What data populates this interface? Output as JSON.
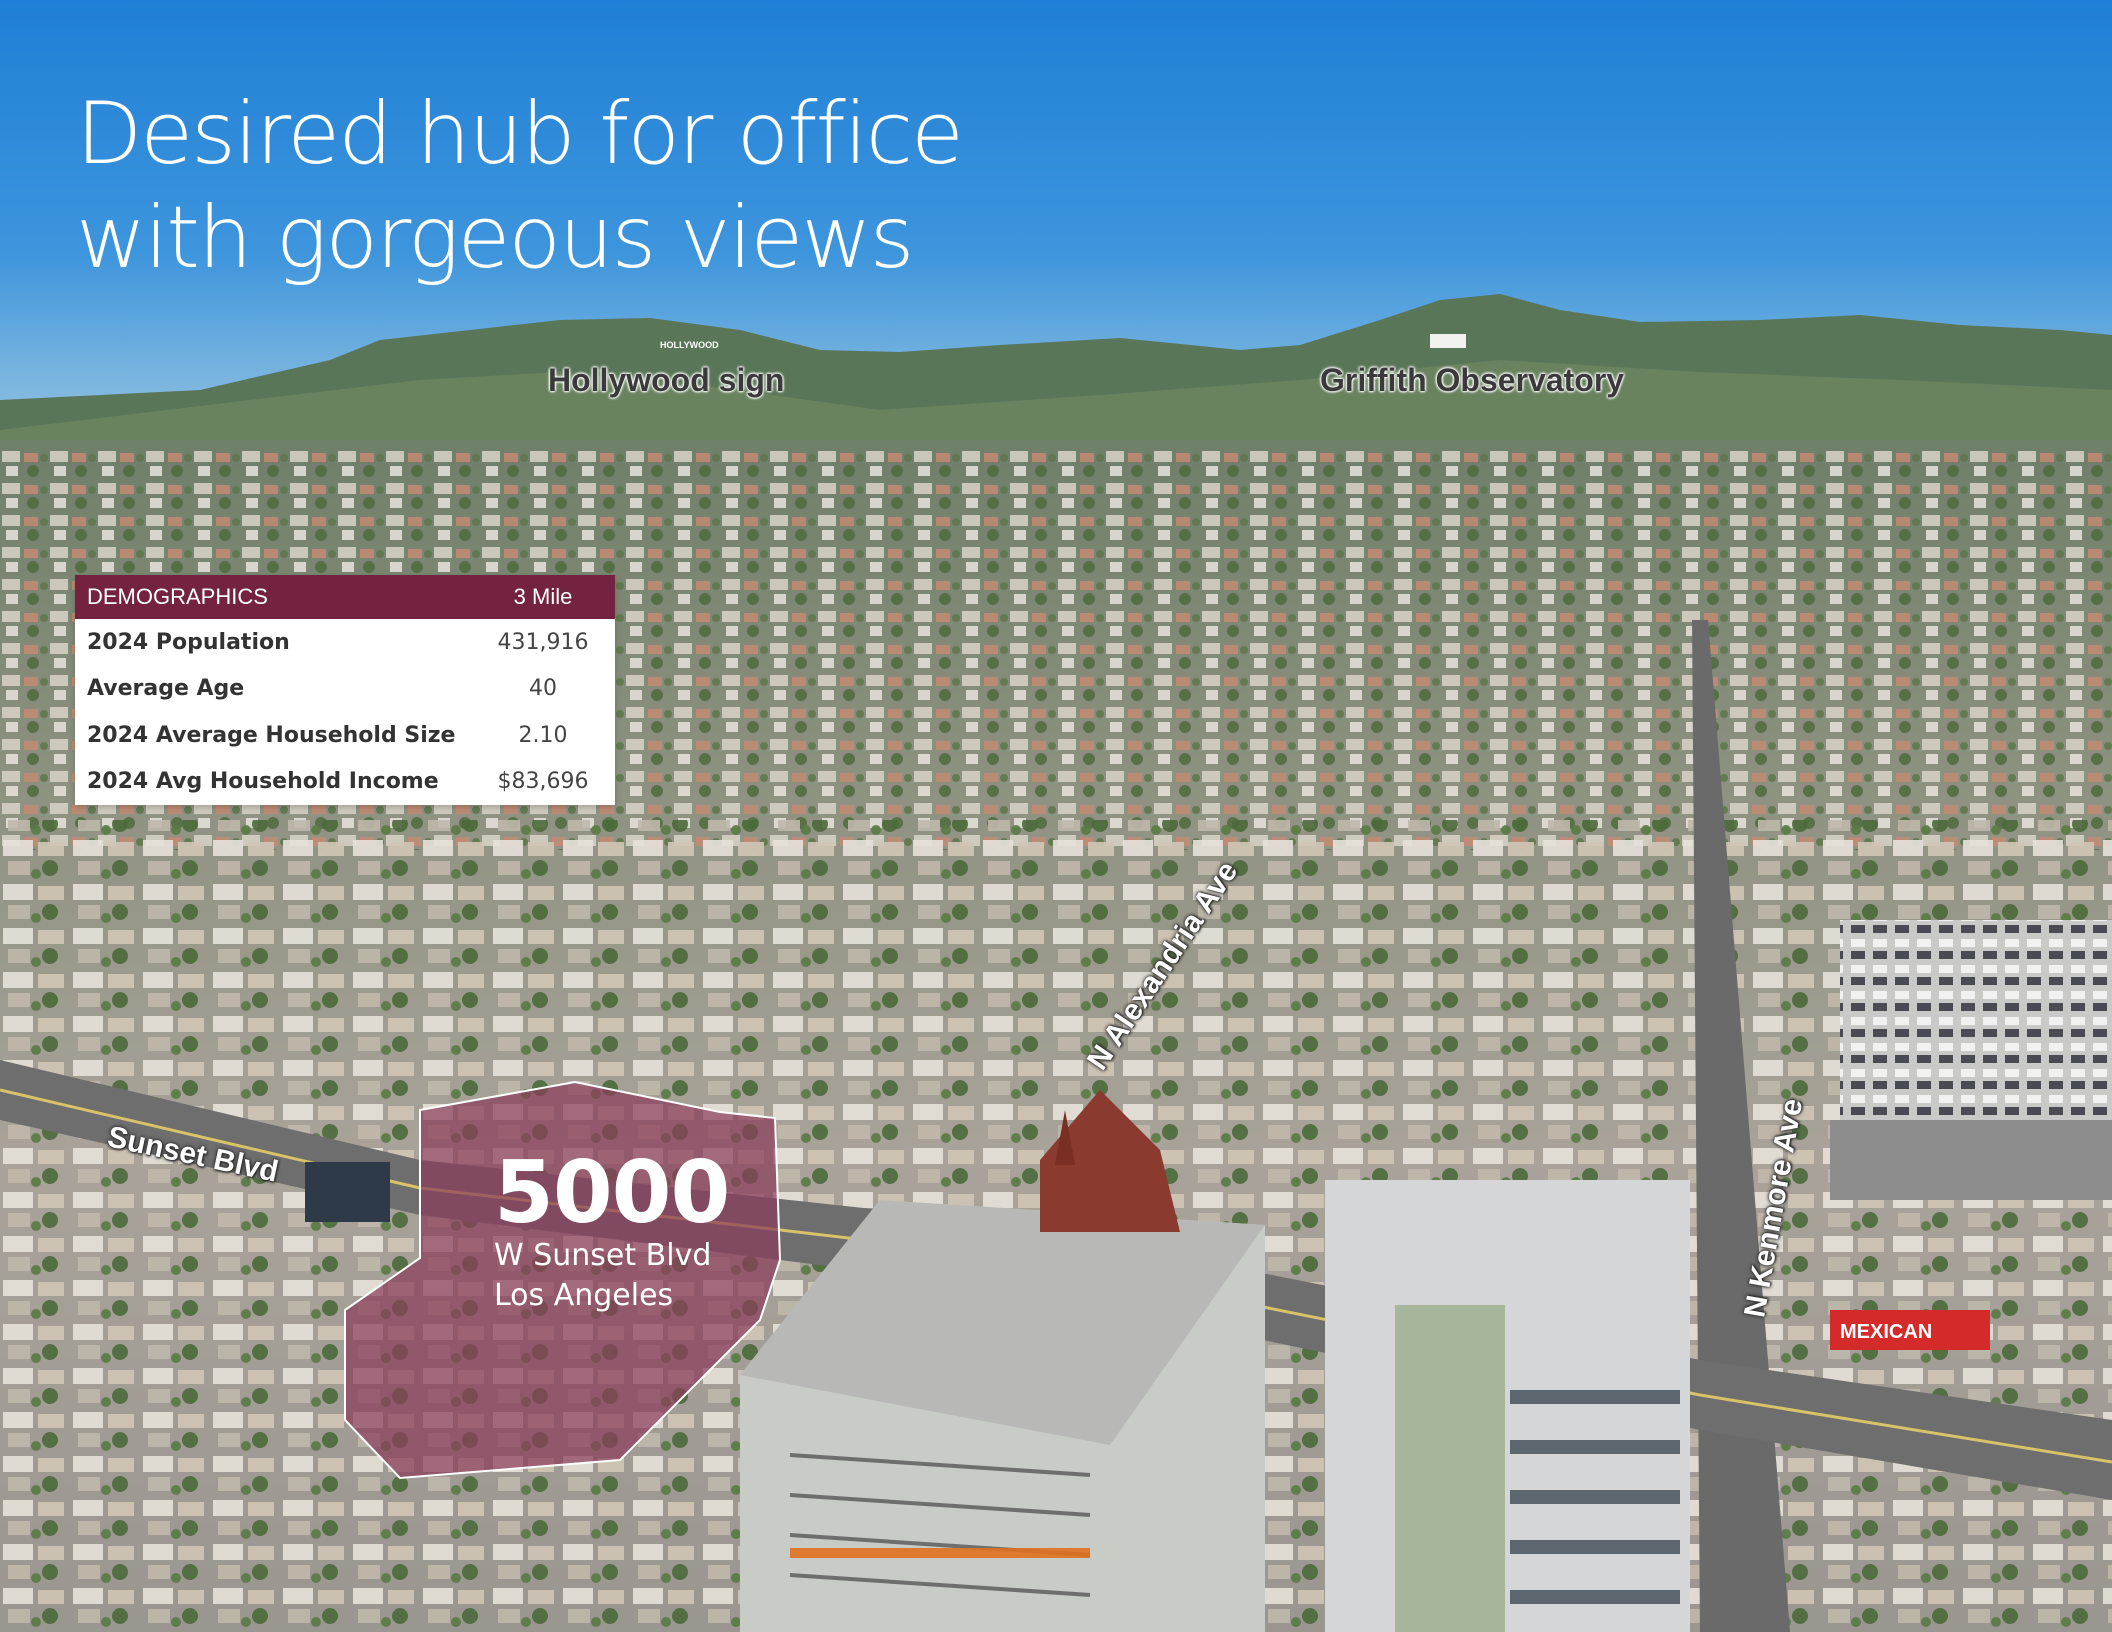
{
  "headline": {
    "line1": "Desired hub for office",
    "line2": "with gorgeous views"
  },
  "landmarks": {
    "hollywood_sign": "Hollywood sign",
    "griffith_observatory": "Griffith Observatory",
    "hollywood_letters": "HOLLYWOOD"
  },
  "streets": {
    "sunset": "Sunset Blvd",
    "alexandria": "N Alexandria Ave",
    "kenmore": "N Kenmore Ave"
  },
  "demographics": {
    "header_label": "DEMOGRAPHICS",
    "header_radius": "3 Mile",
    "rows": [
      {
        "label": "2024 Population",
        "value": "431,916"
      },
      {
        "label": "Average Age",
        "value": "40"
      },
      {
        "label": "2024 Average Household Size",
        "value": "2.10"
      },
      {
        "label": "2024 Avg Household Income",
        "value": "$83,696"
      }
    ]
  },
  "property": {
    "number": "5000",
    "street": "W Sunset Blvd",
    "city": "Los Angeles"
  },
  "signage": {
    "restaurant": "MEXICAN"
  },
  "colors": {
    "sky": "#2f86d4",
    "table_header": "#73233f",
    "highlight": "#8a3d5c"
  }
}
